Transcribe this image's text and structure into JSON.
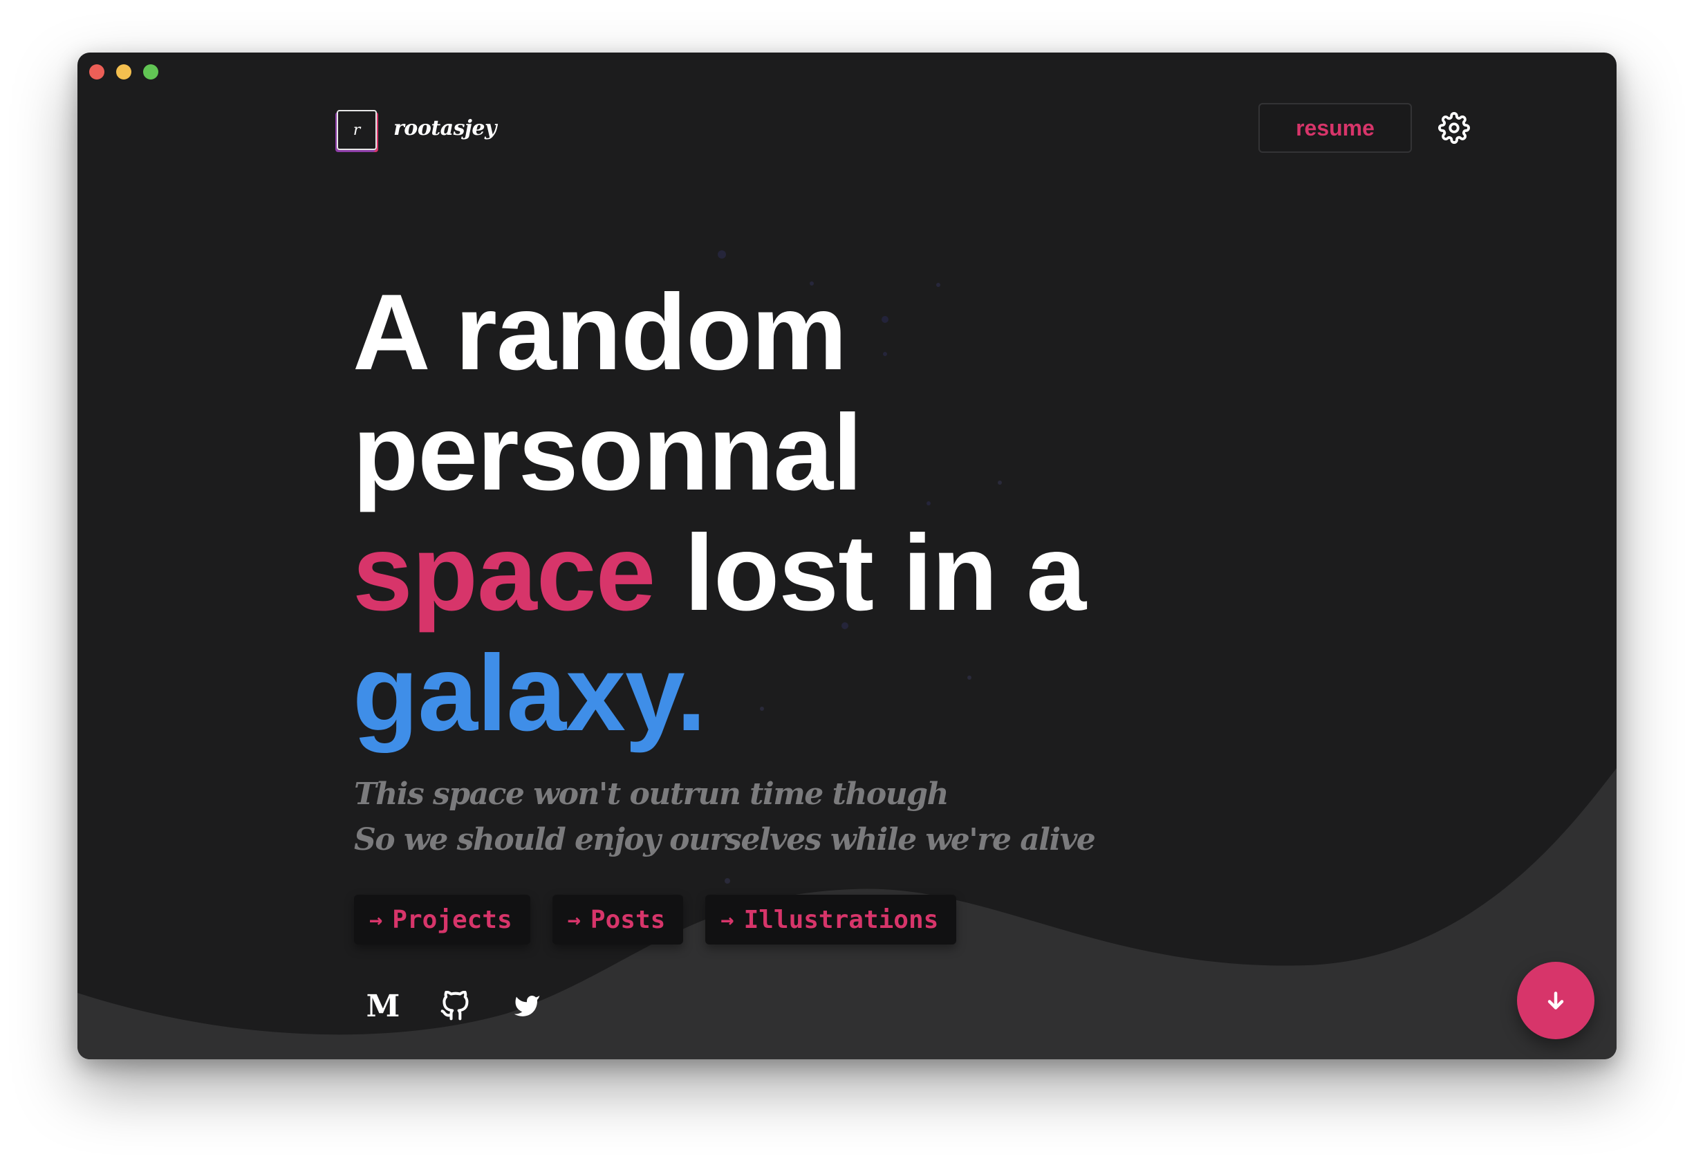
{
  "brand": {
    "logo_letter": "r",
    "name": "rootasjey"
  },
  "header": {
    "resume_label": "resume"
  },
  "hero": {
    "line1": "A random",
    "line2": "personnal",
    "line3_accent": "space",
    "line3_rest": " lost in a",
    "line4_accent": "galaxy."
  },
  "tagline": {
    "line1": "This space won't outrun time though",
    "line2": "So we should enjoy ourselves while we're alive"
  },
  "links": [
    {
      "label": "Projects"
    },
    {
      "label": "Posts"
    },
    {
      "label": "Illustrations"
    }
  ],
  "socials": {
    "medium_letter": "M"
  },
  "colors": {
    "background": "#1c1c1d",
    "accent_pink": "#d7356a",
    "accent_blue": "#3f8ee8",
    "wave": "#303031"
  },
  "icons": [
    "settings-gear-icon",
    "arrow-right-icon",
    "medium-icon",
    "github-icon",
    "twitter-icon",
    "arrow-down-icon"
  ]
}
